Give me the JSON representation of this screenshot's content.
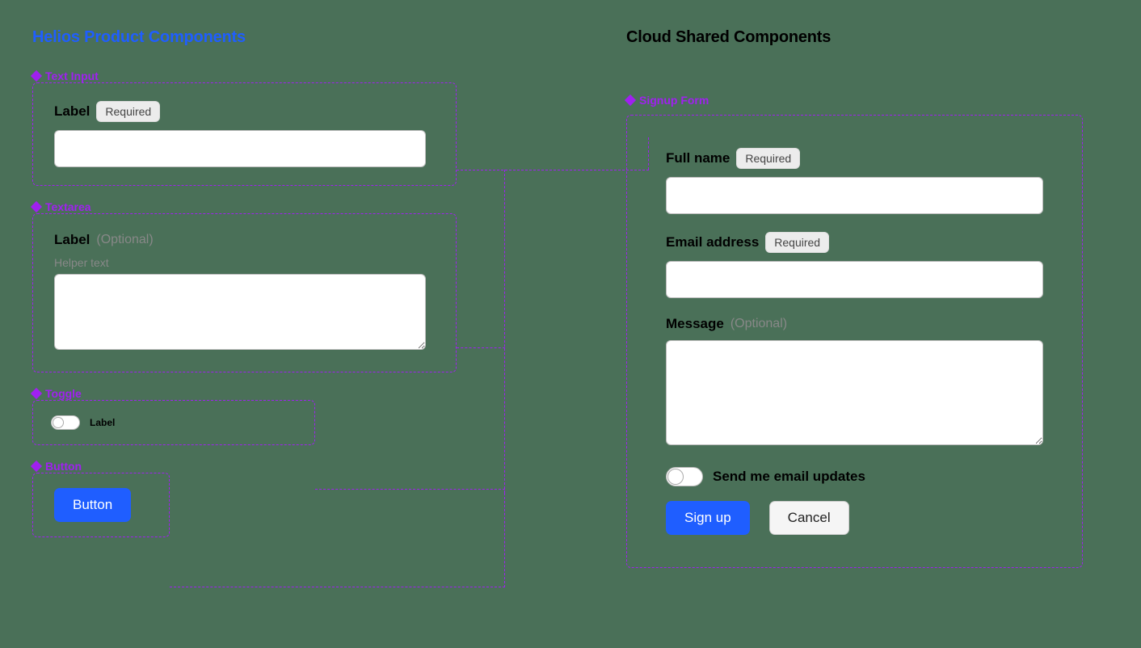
{
  "left": {
    "title": "Helios Product Components",
    "components": {
      "text_input": {
        "tag": "Text Input",
        "label": "Label",
        "required_badge": "Required"
      },
      "textarea": {
        "tag": "Textarea",
        "label": "Label",
        "optional": "(Optional)",
        "helper": "Helper text"
      },
      "toggle": {
        "tag": "Toggle",
        "label": "Label"
      },
      "button": {
        "tag": "Button",
        "label": "Button"
      }
    }
  },
  "right": {
    "title": "Cloud Shared Components",
    "signup": {
      "tag": "Signup Form",
      "full_name": {
        "label": "Full name",
        "required_badge": "Required"
      },
      "email": {
        "label": "Email address",
        "required_badge": "Required"
      },
      "message": {
        "label": "Message",
        "optional": "(Optional)"
      },
      "email_updates": "Send me email updates",
      "signup_btn": "Sign up",
      "cancel_btn": "Cancel"
    }
  }
}
